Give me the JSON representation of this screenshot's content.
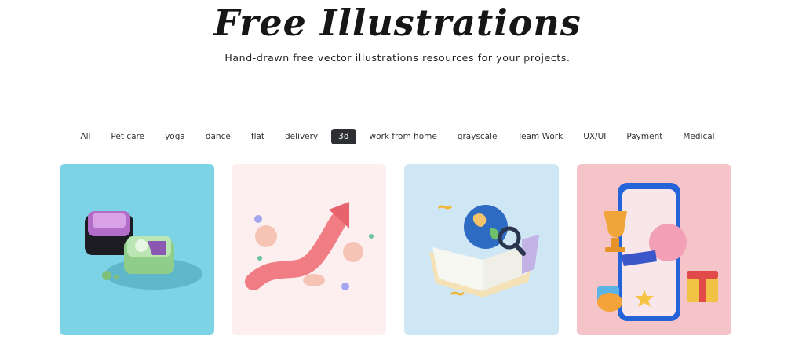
{
  "header": {
    "title": "Free Illustrations",
    "subtitle": "Hand-drawn free vector illustrations resources for your projects."
  },
  "filters": {
    "items": [
      "All",
      "Pet care",
      "yoga",
      "dance",
      "flat",
      "delivery",
      "3d",
      "work from home",
      "grayscale",
      "Team Work",
      "UX/UI",
      "Payment",
      "Medical"
    ],
    "active": "3d"
  },
  "cards": [
    {
      "icon": "3d-containers-illustration",
      "background": "#7dd3e6"
    },
    {
      "icon": "3d-growth-arrow-illustration",
      "background": "#fdeff0"
    },
    {
      "icon": "3d-globe-book-illustration",
      "background": "#cfe6f5"
    },
    {
      "icon": "3d-phone-trophy-illustration",
      "background": "#f4c4c8"
    }
  ],
  "colors": {
    "active_filter_bg": "#2d2f33"
  }
}
